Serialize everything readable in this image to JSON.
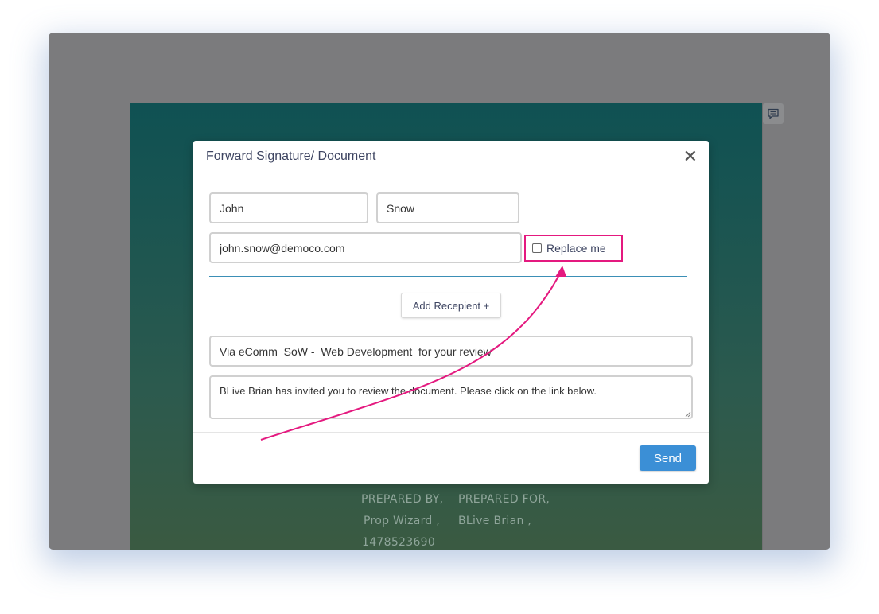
{
  "modal": {
    "title": "Forward Signature/ Document",
    "close_icon": "close-icon",
    "first_name": {
      "value": "John"
    },
    "last_name": {
      "value": "Snow"
    },
    "email": {
      "value": "john.snow@democo.com"
    },
    "replace_label": "Replace me",
    "add_recipient_label": "Add Recepient +",
    "subject": {
      "value": "Via eComm  SoW -  Web Development  for your review"
    },
    "message": {
      "value": "BLive Brian has invited you to review the document. Please click on the link below."
    },
    "send_label": "Send"
  },
  "document": {
    "prepared_by_label": "PREPARED BY,",
    "prepared_by_name": "Prop  Wizard ,",
    "prepared_by_phone": "1478523690",
    "prepared_for_label": "PREPARED FOR,",
    "prepared_for_name": "BLive  Brian ,"
  },
  "colors": {
    "annotation": "#e4197f",
    "accent": "#3b8fd6",
    "divider": "#3b8fb6"
  }
}
